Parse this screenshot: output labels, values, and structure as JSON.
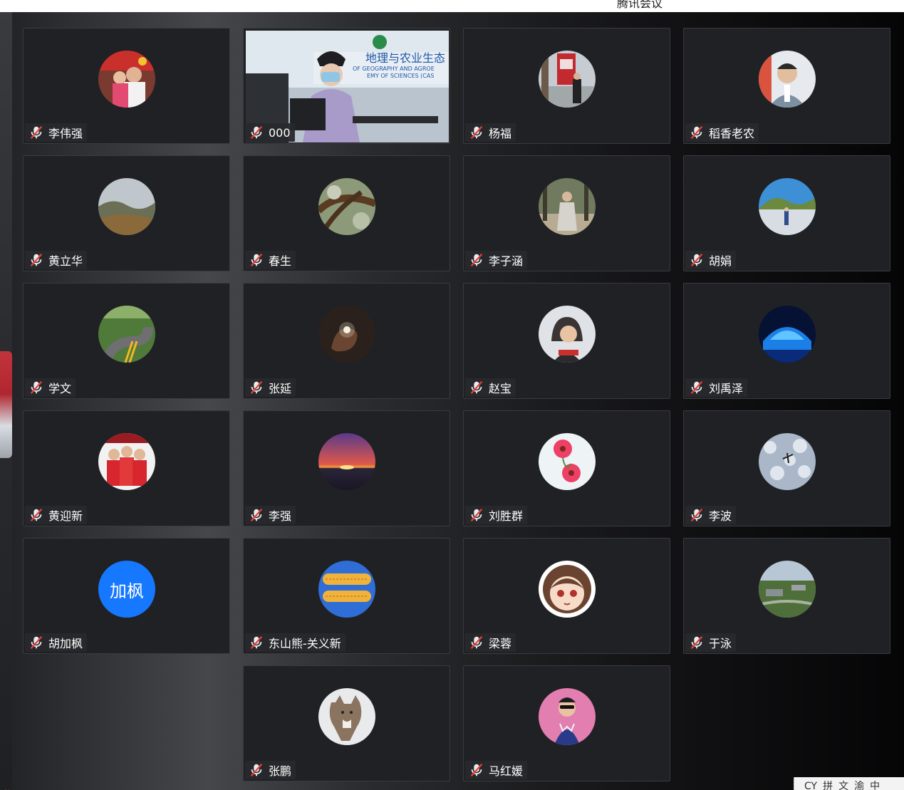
{
  "app": {
    "title": "腾讯会议"
  },
  "input_method": {
    "items": [
      "CY",
      "拼",
      "文",
      "渝",
      "中"
    ]
  },
  "colors": {
    "muted_mic": "#e9ecef",
    "mute_slash": "#e8413b",
    "text_avatar_bg": "#1677ff"
  },
  "participants": [
    {
      "name": "李伟强",
      "avatar": "family-photo",
      "muted": true
    },
    {
      "name": "000",
      "avatar": "live-video-woman-at-laptop",
      "muted": true,
      "video_on": true
    },
    {
      "name": "杨福",
      "avatar": "man-by-red-sign",
      "muted": true
    },
    {
      "name": "稻香老农",
      "avatar": "man-portrait",
      "muted": true
    },
    {
      "name": "黄立华",
      "avatar": "landscape-hills",
      "muted": true
    },
    {
      "name": "春生",
      "avatar": "tree-branches",
      "muted": true
    },
    {
      "name": "李子涵",
      "avatar": "person-in-woods",
      "muted": true
    },
    {
      "name": "胡娟",
      "avatar": "mountain-lake",
      "muted": true
    },
    {
      "name": "学文",
      "avatar": "winding-road",
      "muted": true
    },
    {
      "name": "张延",
      "avatar": "hand-holding-light",
      "muted": true
    },
    {
      "name": "赵宝",
      "avatar": "child-in-snow",
      "muted": true
    },
    {
      "name": "刘禹泽",
      "avatar": "blue-ice-sculpture",
      "muted": true
    },
    {
      "name": "黄迎新",
      "avatar": "family-red-clothes",
      "muted": true
    },
    {
      "name": "李强",
      "avatar": "sunset-sea",
      "muted": true
    },
    {
      "name": "刘胜群",
      "avatar": "pink-flowers",
      "muted": true
    },
    {
      "name": "李波",
      "avatar": "airplane-in-sky",
      "muted": true
    },
    {
      "name": "胡加枫",
      "avatar_text": "加枫",
      "muted": true
    },
    {
      "name": "东山熊-关义新",
      "avatar": "corn-cobs",
      "muted": true
    },
    {
      "name": "梁蓉",
      "avatar": "anime-girl",
      "muted": true
    },
    {
      "name": "于泳",
      "avatar": "campus-aerial",
      "muted": true
    },
    {
      "name": "张鹏",
      "avatar": "running-wolf",
      "muted": true
    },
    {
      "name": "马红媛",
      "avatar": "woman-sunglasses",
      "muted": true
    }
  ],
  "video_feed": {
    "sign_lines": [
      "地理与农业生态",
      "OF GEOGRAPHY AND AGROE",
      "EMY OF SCIENCES (CAS"
    ]
  }
}
